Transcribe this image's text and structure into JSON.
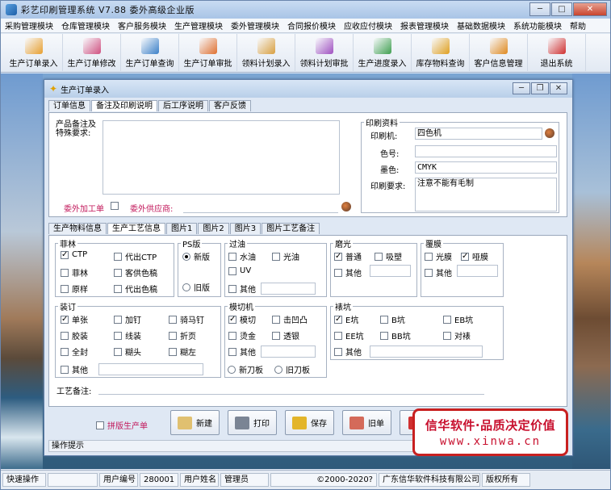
{
  "app": {
    "title": "彩艺印刷管理系统  V7.88  委外高级企业版"
  },
  "menu": [
    "采购管理模块",
    "仓库管理模块",
    "客户服务模块",
    "生产管理模块",
    "委外管理模块",
    "合同报价模块",
    "应收应付模块",
    "报表管理模块",
    "基础数据模块",
    "系统功能模块",
    "帮助"
  ],
  "toolbar": [
    {
      "label": "生产订单录入",
      "icon": "order-entry-icon",
      "color": "#e8a030"
    },
    {
      "label": "生产订单修改",
      "icon": "order-edit-icon",
      "color": "#d05080"
    },
    {
      "label": "生产订单查询",
      "icon": "order-query-icon",
      "color": "#3b80c8"
    },
    {
      "label": "生产订单审批",
      "icon": "order-approve-icon",
      "color": "#e07030"
    },
    {
      "label": "领料计划录入",
      "icon": "material-plan-icon",
      "color": "#d9a040"
    },
    {
      "label": "领料计划审批",
      "icon": "material-approve-icon",
      "color": "#a050c0"
    },
    {
      "label": "生产进度录入",
      "icon": "progress-icon",
      "color": "#40a050"
    },
    {
      "label": "库存物料查询",
      "icon": "inventory-icon",
      "color": "#e0a020"
    },
    {
      "label": "客户信息管理",
      "icon": "customer-icon",
      "color": "#e08a20"
    },
    {
      "label": "退出系统",
      "icon": "exit-icon",
      "color": "#d03030"
    }
  ],
  "child": {
    "title": "生产订单录入",
    "top_tabs": [
      "订单信息",
      "备注及印刷说明",
      "后工序说明",
      "客户反馈"
    ],
    "product_note_label": "产品备注及特殊要求:",
    "outsource_order": "委外加工单",
    "outsource_supplier": "委外供应商:",
    "print_info": {
      "legend": "印刷资料",
      "press_label": "印刷机:",
      "press_value": "四色机",
      "color_no_label": "色号:",
      "color_no_value": "",
      "ink_label": "墨色:",
      "ink_value": "CMYK",
      "req_label": "印刷要求:",
      "req_value": "注意不能有毛制"
    },
    "sub_tabs": [
      "生产物料信息",
      "生产工艺信息",
      "图片1",
      "图片2",
      "图片3",
      "图片工艺备注"
    ],
    "film": {
      "legend": "菲林",
      "items": [
        {
          "label": "CTP",
          "checked": true
        },
        {
          "label": "代出CTP",
          "checked": false
        },
        {
          "label": "菲林",
          "checked": false
        },
        {
          "label": "客供色稿",
          "checked": false
        },
        {
          "label": "原样",
          "checked": false
        },
        {
          "label": "代出色稿",
          "checked": false
        }
      ]
    },
    "ps": {
      "legend": "PS版",
      "new": "新版",
      "old": "旧版"
    },
    "oil": {
      "legend": "过油",
      "items": [
        "水油",
        "光油",
        "UV",
        "其他"
      ]
    },
    "matte": {
      "legend": "磨光",
      "items": [
        "普通",
        "吸塑",
        "其他"
      ]
    },
    "laminate": {
      "legend": "覆膜",
      "items": [
        "光膜",
        "哑膜",
        "其他"
      ]
    },
    "binding": {
      "legend": "装订",
      "items": [
        "单张",
        "加钉",
        "骑马钉",
        "胶装",
        "线装",
        "折页",
        "全封",
        "糊头",
        "糊左",
        "其他"
      ]
    },
    "diecut": {
      "legend": "模切机",
      "items": [
        "模切",
        "击凹凸",
        "烫金",
        "透银",
        "其他"
      ],
      "new_blade": "新刀板",
      "old_blade": "旧刀板"
    },
    "flute": {
      "legend": "裱坑",
      "items": [
        "E坑",
        "B坑",
        "EB坑",
        "EE坑",
        "BB坑",
        "对裱",
        "其他"
      ]
    },
    "process_note_label": "工艺备注:",
    "reprint_label": "拼版生产单",
    "buttons": [
      "新建",
      "打印",
      "保存",
      "旧单"
    ],
    "status_hint": "操作提示"
  },
  "statusbar": {
    "quick": "快速操作",
    "user_no_label": "用户编号",
    "user_no": "280001",
    "user_name_label": "用户姓名",
    "user_name": "管理员",
    "copyright": "©2000-2020?",
    "company": "广东信华软件科技有限公司",
    "rights": "版权所有"
  },
  "banner": {
    "line1": "信华软件·品质决定价值",
    "line2": "www.xinwa.cn"
  }
}
